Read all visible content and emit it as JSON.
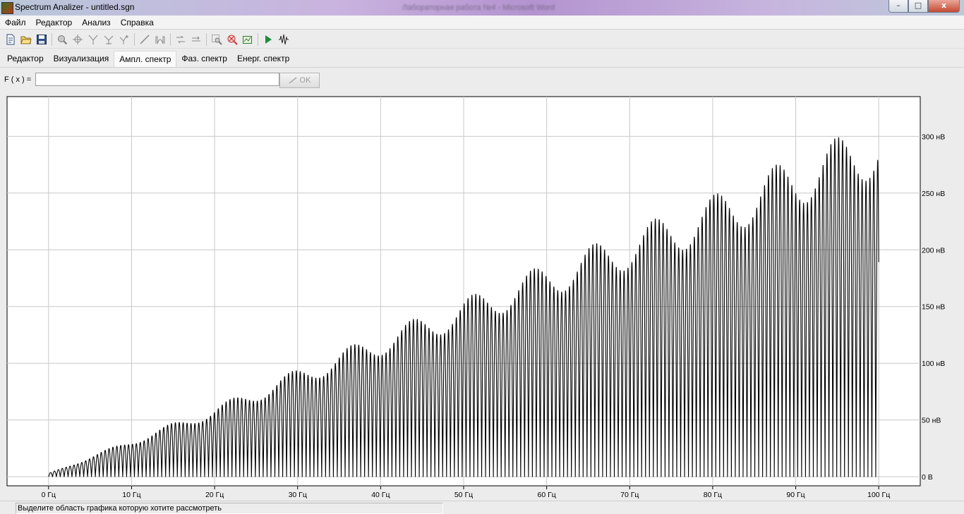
{
  "window": {
    "title": "Spectrum Analizer - untitled.sgn",
    "background_title": "Лабораторная работа №4 - Microsoft Word",
    "minimize": "–",
    "maximize": "□",
    "close": "x"
  },
  "menu": [
    {
      "label": "Файл"
    },
    {
      "label": "Редактор"
    },
    {
      "label": "Анализ"
    },
    {
      "label": "Справка"
    }
  ],
  "toolbar": {
    "groups": [
      [
        "new-icon",
        "open-icon",
        "save-icon"
      ],
      [
        "zoom-icon",
        "crosshair-icon",
        "filter-icon",
        "filter-alt-icon",
        "filter-plus-icon"
      ],
      [
        "line-icon",
        "window-function-icon"
      ],
      [
        "swap-icon",
        "swap-alt-icon"
      ],
      [
        "zoom-area-icon",
        "zoom-reset-icon",
        "export-icon"
      ],
      [
        "run-icon",
        "signal-icon"
      ]
    ]
  },
  "tabs": [
    {
      "label": "Редактор",
      "active": false
    },
    {
      "label": "Визуализация",
      "active": false
    },
    {
      "label": "Ампл. спектр",
      "active": true
    },
    {
      "label": "Фаз. спектр",
      "active": false
    },
    {
      "label": "Енерг. спектр",
      "active": false
    }
  ],
  "formula": {
    "label": "F ( x ) =",
    "value": "",
    "ok_label": "OK"
  },
  "chart_data": {
    "type": "line",
    "title": "",
    "xlabel": "",
    "ylabel": "",
    "x_ticks": [
      "0 Гц",
      "10 Гц",
      "20 Гц",
      "30 Гц",
      "40 Гц",
      "50 Гц",
      "60 Гц",
      "70 Гц",
      "80 Гц",
      "90 Гц",
      "100 Гц"
    ],
    "y_ticks": [
      "0 В",
      "50 нВ",
      "100 нВ",
      "150 нВ",
      "200 нВ",
      "250 нВ",
      "300 нВ"
    ],
    "xlim": [
      -5,
      105
    ],
    "ylim": [
      -8,
      335
    ],
    "grid": true,
    "series": [
      {
        "envelope_x": [
          0,
          10,
          20,
          30,
          40,
          50,
          60,
          70,
          80,
          90,
          100
        ],
        "envelope_y": [
          3,
          33,
          62,
          95,
          127,
          157,
          188,
          218,
          248,
          283,
          315
        ],
        "oscillation_period_hz": 0.47,
        "color": "#000000"
      }
    ]
  },
  "status": {
    "text": "Выделите область графика которую хотите рассмотреть"
  }
}
